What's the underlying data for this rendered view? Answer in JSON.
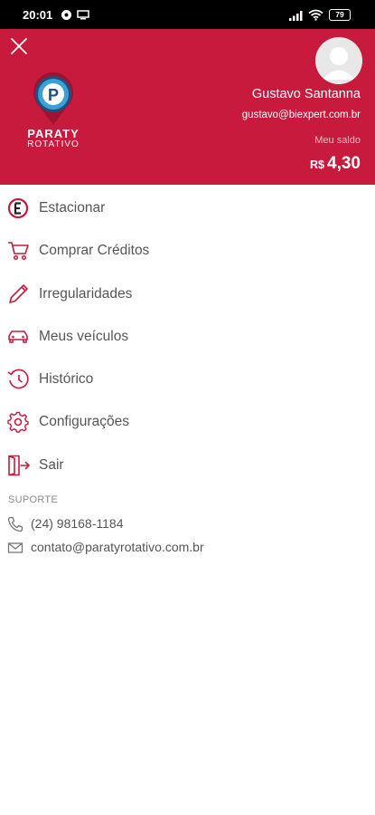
{
  "status_bar": {
    "time": "20:01",
    "battery": "79"
  },
  "header": {
    "brand": {
      "line1": "PARATY",
      "line2": "ROTATIVO",
      "logo_letter": "P"
    },
    "user_name": "Gustavo Santanna",
    "user_email": "gustavo@biexpert.com.br",
    "balance_label": "Meu saldo",
    "balance_currency": "R$",
    "balance_value": "4,30",
    "accent_color": "#c81a3c"
  },
  "menu": {
    "items": [
      {
        "label": "Estacionar",
        "icon": "parking-e-icon"
      },
      {
        "label": "Comprar Créditos",
        "icon": "cart-icon"
      },
      {
        "label": "Irregularidades",
        "icon": "pencil-icon"
      },
      {
        "label": "Meus veículos",
        "icon": "car-icon"
      },
      {
        "label": "Histórico",
        "icon": "history-icon"
      },
      {
        "label": "Configurações",
        "icon": "gear-icon"
      },
      {
        "label": "Sair",
        "icon": "logout-icon"
      }
    ]
  },
  "support": {
    "title": "SUPORTE",
    "phone": "(24) 98168-1184",
    "email": "contato@paratyrotativo.com.br"
  }
}
